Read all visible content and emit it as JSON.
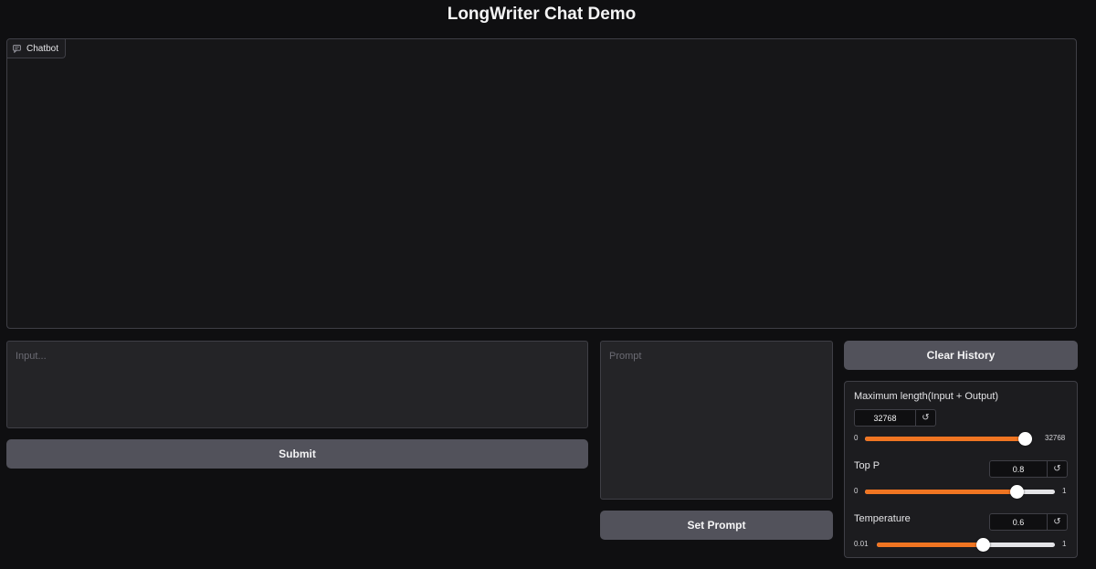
{
  "page": {
    "title": "LongWriter Chat Demo"
  },
  "chatbot": {
    "label": "Chatbot",
    "icon": "chat-bubble-icon"
  },
  "input": {
    "placeholder": "Input..."
  },
  "submit": {
    "label": "Submit"
  },
  "prompt": {
    "placeholder": "Prompt"
  },
  "set_prompt": {
    "label": "Set Prompt"
  },
  "clear_history": {
    "label": "Clear History"
  },
  "settings": {
    "max_length": {
      "label": "Maximum length(Input + Output)",
      "value": "32768",
      "min": "0",
      "max": "32768",
      "fraction": 1.0
    },
    "top_p": {
      "label": "Top P",
      "value": "0.8",
      "min": "0",
      "max": "1",
      "fraction": 0.8
    },
    "temperature": {
      "label": "Temperature",
      "value": "0.6",
      "min": "0.01",
      "max": "1",
      "fraction": 0.596
    },
    "reset_glyph": "↺"
  },
  "colors": {
    "accent": "#f07522",
    "background": "#0f0f11",
    "button": "#52525b"
  }
}
